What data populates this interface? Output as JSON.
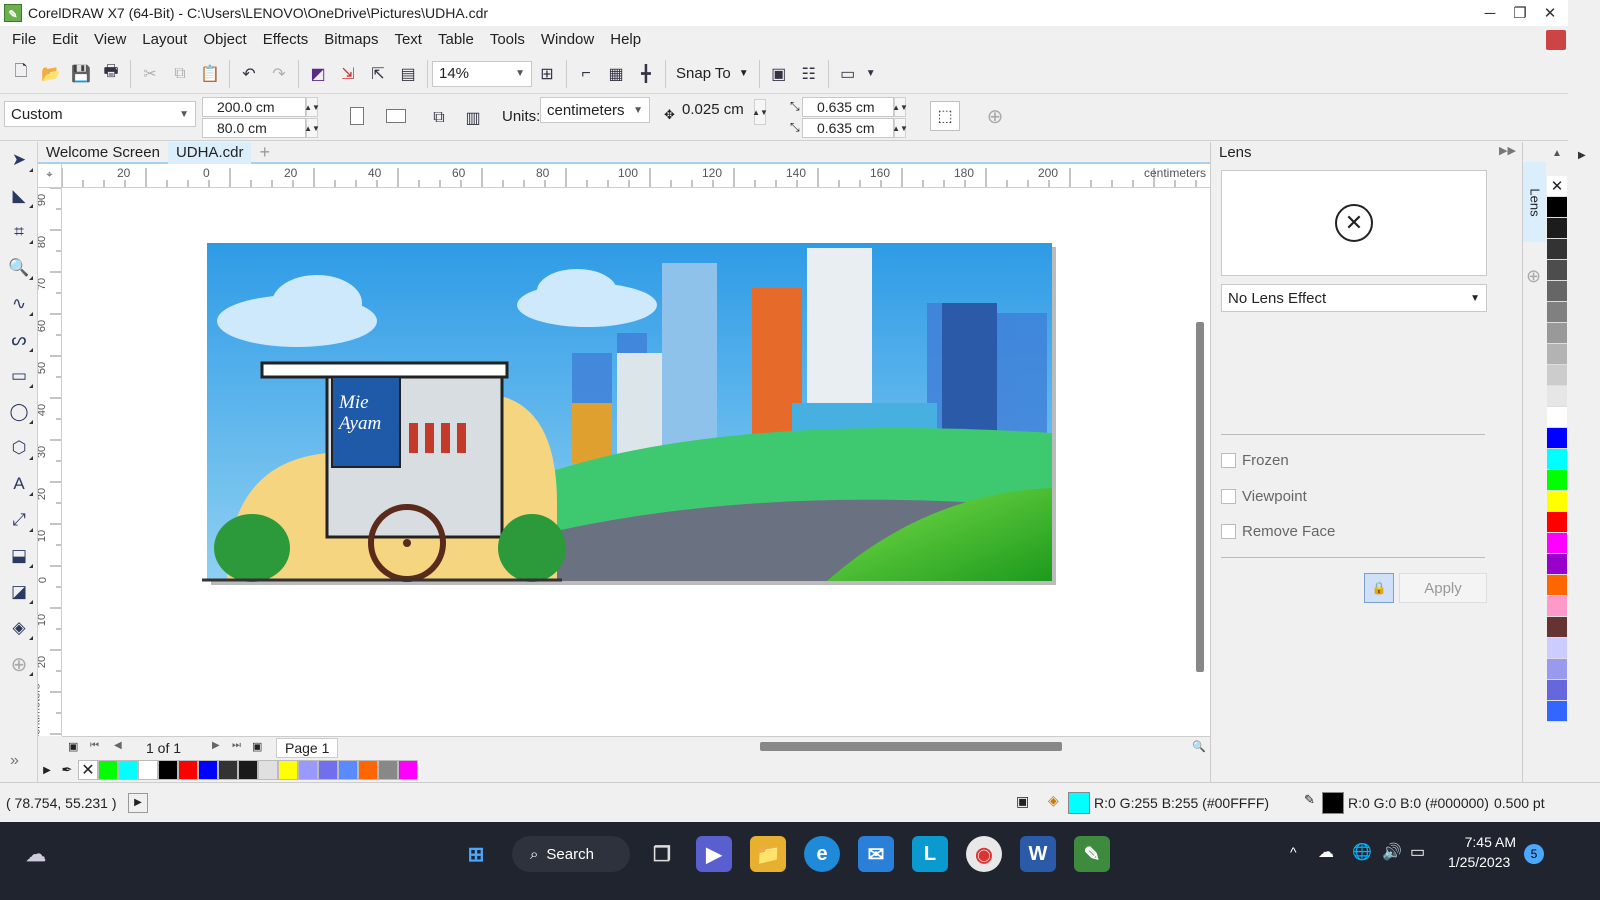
{
  "window": {
    "title": "CorelDRAW X7 (64-Bit) - C:\\Users\\LENOVO\\OneDrive\\Pictures\\UDHA.cdr",
    "controls": {
      "minimize": "─",
      "restore": "❐",
      "close": "✕"
    }
  },
  "menu": [
    "File",
    "Edit",
    "View",
    "Layout",
    "Object",
    "Effects",
    "Bitmaps",
    "Text",
    "Table",
    "Tools",
    "Window",
    "Help"
  ],
  "toolbar": {
    "zoom": "14%",
    "snap_to": "Snap To"
  },
  "property_bar": {
    "page_preset": "Custom",
    "width": "200.0 cm",
    "height": "80.0 cm",
    "units_label": "Units:",
    "units": "centimeters",
    "nudge": "0.025 cm",
    "dup_x": "0.635 cm",
    "dup_y": "0.635 cm"
  },
  "tabs": [
    {
      "label": "Welcome Screen",
      "active": false
    },
    {
      "label": "UDHA.cdr",
      "active": true
    }
  ],
  "ruler": {
    "h_ticks": [
      "20",
      "0",
      "20",
      "40",
      "60",
      "80",
      "100",
      "120",
      "140",
      "160",
      "180",
      "200"
    ],
    "h_unit": "centimeters",
    "v_ticks": [
      "90",
      "80",
      "70",
      "60",
      "50",
      "40",
      "30",
      "20",
      "10",
      "0",
      "10",
      "20"
    ],
    "v_unit": "centimeters"
  },
  "artwork": {
    "cart_sign_line1": "Mie",
    "cart_sign_line2": "Ayam"
  },
  "page_nav": {
    "count": "1 of 1",
    "page_tab": "Page 1"
  },
  "bottom_palette": [
    "#00ff00",
    "#00ffff",
    "#ffffff",
    "#000000",
    "#ff0000",
    "#0000ff",
    "#333333",
    "#1a1a1a",
    "#e0e0e0",
    "#ffff00",
    "#9999ff",
    "#7070ee",
    "#5a8aff",
    "#ff6600",
    "#888888",
    "#ff00ff"
  ],
  "right_palette": [
    "#000000",
    "#1c1c1c",
    "#333333",
    "#4d4d4d",
    "#666666",
    "#808080",
    "#999999",
    "#b3b3b3",
    "#cccccc",
    "#e6e6e6",
    "#ffffff",
    "#0000ff",
    "#00ffff",
    "#00ff00",
    "#ffff00",
    "#ff0000",
    "#ff00ff",
    "#9900cc",
    "#ff6600",
    "#ff99cc",
    "#663333",
    "#ccccff",
    "#9999ee",
    "#6666dd",
    "#3366ff"
  ],
  "docker": {
    "title": "Lens",
    "tab_label": "Lens",
    "effect": "No Lens Effect",
    "options": [
      "Frozen",
      "Viewpoint",
      "Remove Face"
    ],
    "apply": "Apply"
  },
  "status": {
    "coords": "( 78.754, 55.231 )",
    "fill_text": "R:0 G:255 B:255 (#00FFFF)",
    "fill_color": "#00ffff",
    "outline_text": "R:0 G:0 B:0 (#000000)",
    "outline_color": "#000000",
    "outline_width": "0.500 pt"
  },
  "taskbar": {
    "search": "Search",
    "time": "7:45 AM",
    "date": "1/25/2023",
    "notifications": "5"
  }
}
